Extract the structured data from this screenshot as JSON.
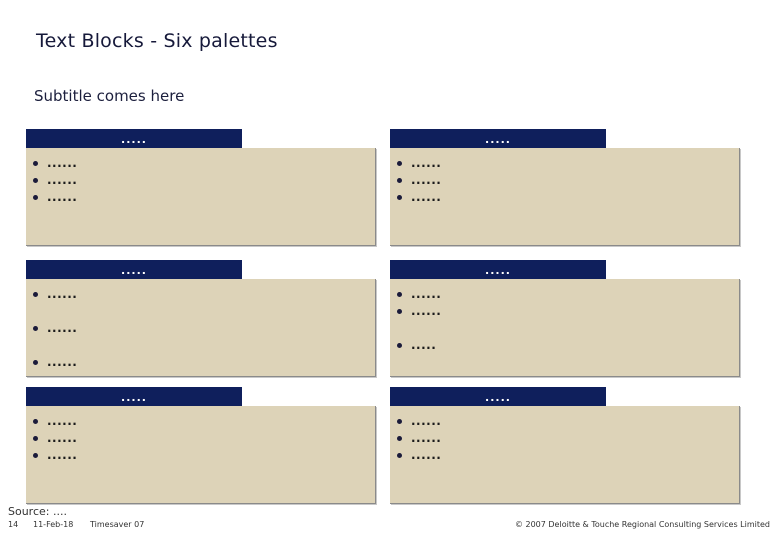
{
  "header": {
    "title": "Text Blocks - Six palettes",
    "subtitle": "Subtitle comes here"
  },
  "colors": {
    "header_bar": "#0f1f5c",
    "block_body": "#ddd3b8",
    "bullet": "#1b1b3a"
  },
  "blocks": [
    {
      "heading": ".....",
      "bullets": [
        "......",
        "......",
        "......"
      ]
    },
    {
      "heading": ".....",
      "bullets": [
        "......",
        "......",
        "......"
      ]
    },
    {
      "heading": ".....",
      "bullets": [
        "......",
        "......",
        "......"
      ]
    },
    {
      "heading": ".....",
      "bullets": [
        "......",
        "......",
        "....."
      ]
    },
    {
      "heading": ".....",
      "bullets": [
        "......",
        "......",
        "......"
      ]
    },
    {
      "heading": ".....",
      "bullets": [
        "......",
        "......",
        "......"
      ]
    }
  ],
  "footer": {
    "source": "Source: ....",
    "page_number": "14",
    "date": "11-Feb-18",
    "document": "Timesaver 07",
    "copyright": "© 2007 Deloitte & Touche Regional Consulting Services Limited"
  }
}
